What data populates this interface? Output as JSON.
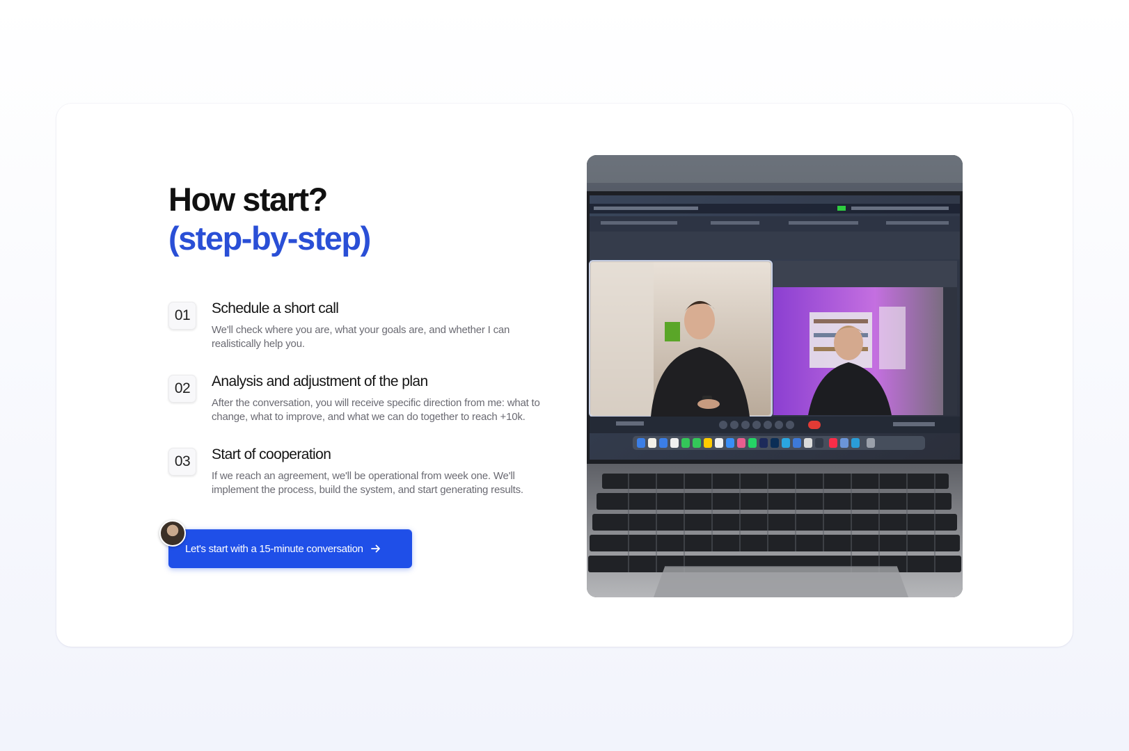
{
  "header": {
    "title": "How start?",
    "subtitle": "(step-by-step)"
  },
  "steps": [
    {
      "number": "01",
      "title": "Schedule a short call",
      "description": "We'll check where you are, what your goals are, and whether I can realistically help you."
    },
    {
      "number": "02",
      "title": "Analysis and adjustment of the plan",
      "description": "After the conversation, you will receive specific direction from me: what to change, what to improve, and what we can do together to reach +10k."
    },
    {
      "number": "03",
      "title": "Start of cooperation",
      "description": "If we reach an agreement, we'll be operational from week one. We'll implement the process, build the system, and start generating results."
    }
  ],
  "cta": {
    "label": "Let's start with a 15-minute conversation",
    "icon": "arrow-right-icon"
  },
  "colors": {
    "accent": "#1f4fe8",
    "subtitle": "#2a4fd6",
    "text": "#111111",
    "muted": "#6a6a72"
  }
}
